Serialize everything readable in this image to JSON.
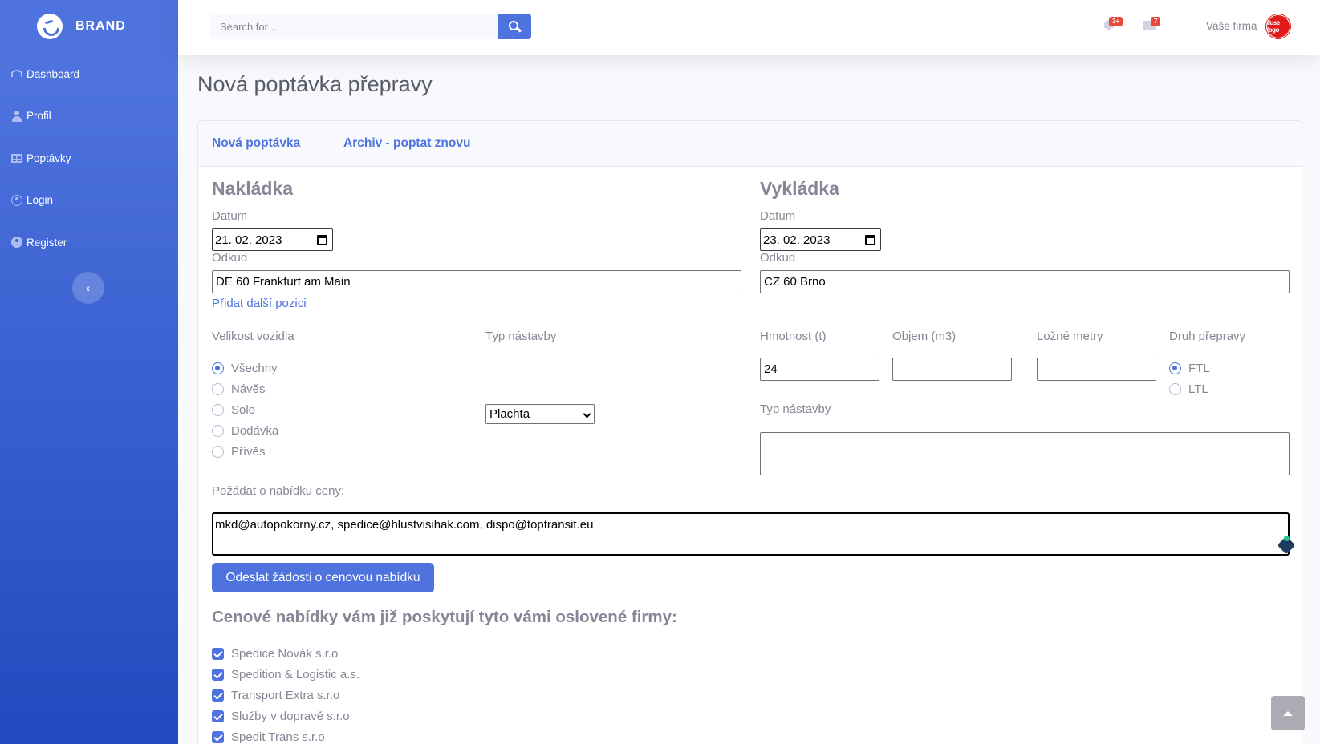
{
  "brand": {
    "name": "BRAND"
  },
  "sidebar": {
    "items": [
      {
        "label": "Dashboard",
        "icon": "dashboard-icon"
      },
      {
        "label": "Profil",
        "icon": "user-icon"
      },
      {
        "label": "Poptávky",
        "icon": "table-icon"
      },
      {
        "label": "Login",
        "icon": "user-circle-icon"
      },
      {
        "label": "Register",
        "icon": "user-circle-filled-icon"
      }
    ]
  },
  "topbar": {
    "search_placeholder": "Search for ...",
    "alerts_badge": "3+",
    "messages_badge": "7",
    "user_name": "Vaše firma",
    "avatar_text": "lluse logo"
  },
  "page": {
    "title": "Nová poptávka přepravy",
    "tabs": [
      "Nová poptávka",
      "Archiv - poptat znovu"
    ]
  },
  "loading": {
    "heading": "Nakládka",
    "date_label": "Datum",
    "date_value": "21. 02. 2023",
    "from_label": "Odkud",
    "from_value": "DE 60 Frankfurt am Main",
    "add_position": "Přidat další pozici"
  },
  "unloading": {
    "heading": "Vykládka",
    "date_label": "Datum",
    "date_value": "23. 02. 2023",
    "from_label": "Odkud",
    "from_value": "CZ 60 Brno"
  },
  "vehicle": {
    "size_label": "Velikost vozidla",
    "sizes": [
      "Všechny",
      "Návěs",
      "Solo",
      "Dodávka",
      "Přívěs"
    ],
    "size_selected": "Všechny",
    "body_label": "Typ nástavby",
    "body_value": "Plachta"
  },
  "cargo": {
    "weight_label": "Hmotnost (t)",
    "weight_value": "24",
    "volume_label": "Objem (m3)",
    "volume_value": "",
    "ldm_label": "Ložné metry",
    "ldm_value": "",
    "transport_label": "Druh přepravy",
    "transport_options": [
      "FTL",
      "LTL"
    ],
    "transport_selected": "FTL",
    "body_note_label": "Typ nástavby"
  },
  "request": {
    "label": "Požádat o nabídku ceny:",
    "emails": "mkd@autopokorny.cz, spedice@hlustvisihak.com, dispo@toptransit.eu",
    "submit": "Odeslat žádosti o cenovou nabídku"
  },
  "offers": {
    "heading": "Cenové nabídky vám již poskytují tyto vámi oslovené firmy:",
    "companies": [
      "Spedice Novák s.r.o",
      "Spedition & Logistic a.s.",
      "Transport Extra s.r.o",
      "Služby v dopravě s.r.o",
      "Spedit Trans s.r.o"
    ]
  },
  "colors": {
    "primary": "#4e73df",
    "sidebar_gradient_end": "#224abe",
    "badge": "#e74a3b",
    "text_muted": "#858796"
  }
}
